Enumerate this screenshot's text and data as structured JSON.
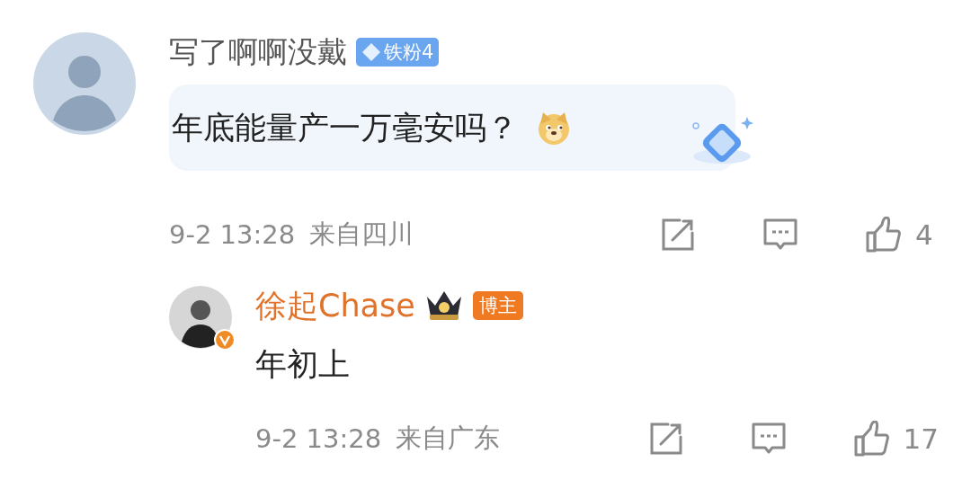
{
  "comment": {
    "author": "写了啊啊没戴",
    "fan_badge": "铁粉4",
    "text": "年底能量产一万毫安吗？",
    "time": "9-2 13:28",
    "location": "来自四川",
    "likes": "4"
  },
  "reply": {
    "author": "徐起Chase",
    "role_badge": "博主",
    "verified": true,
    "text": "年初上",
    "time": "9-2 13:28",
    "location": "来自广东",
    "likes": "17"
  }
}
